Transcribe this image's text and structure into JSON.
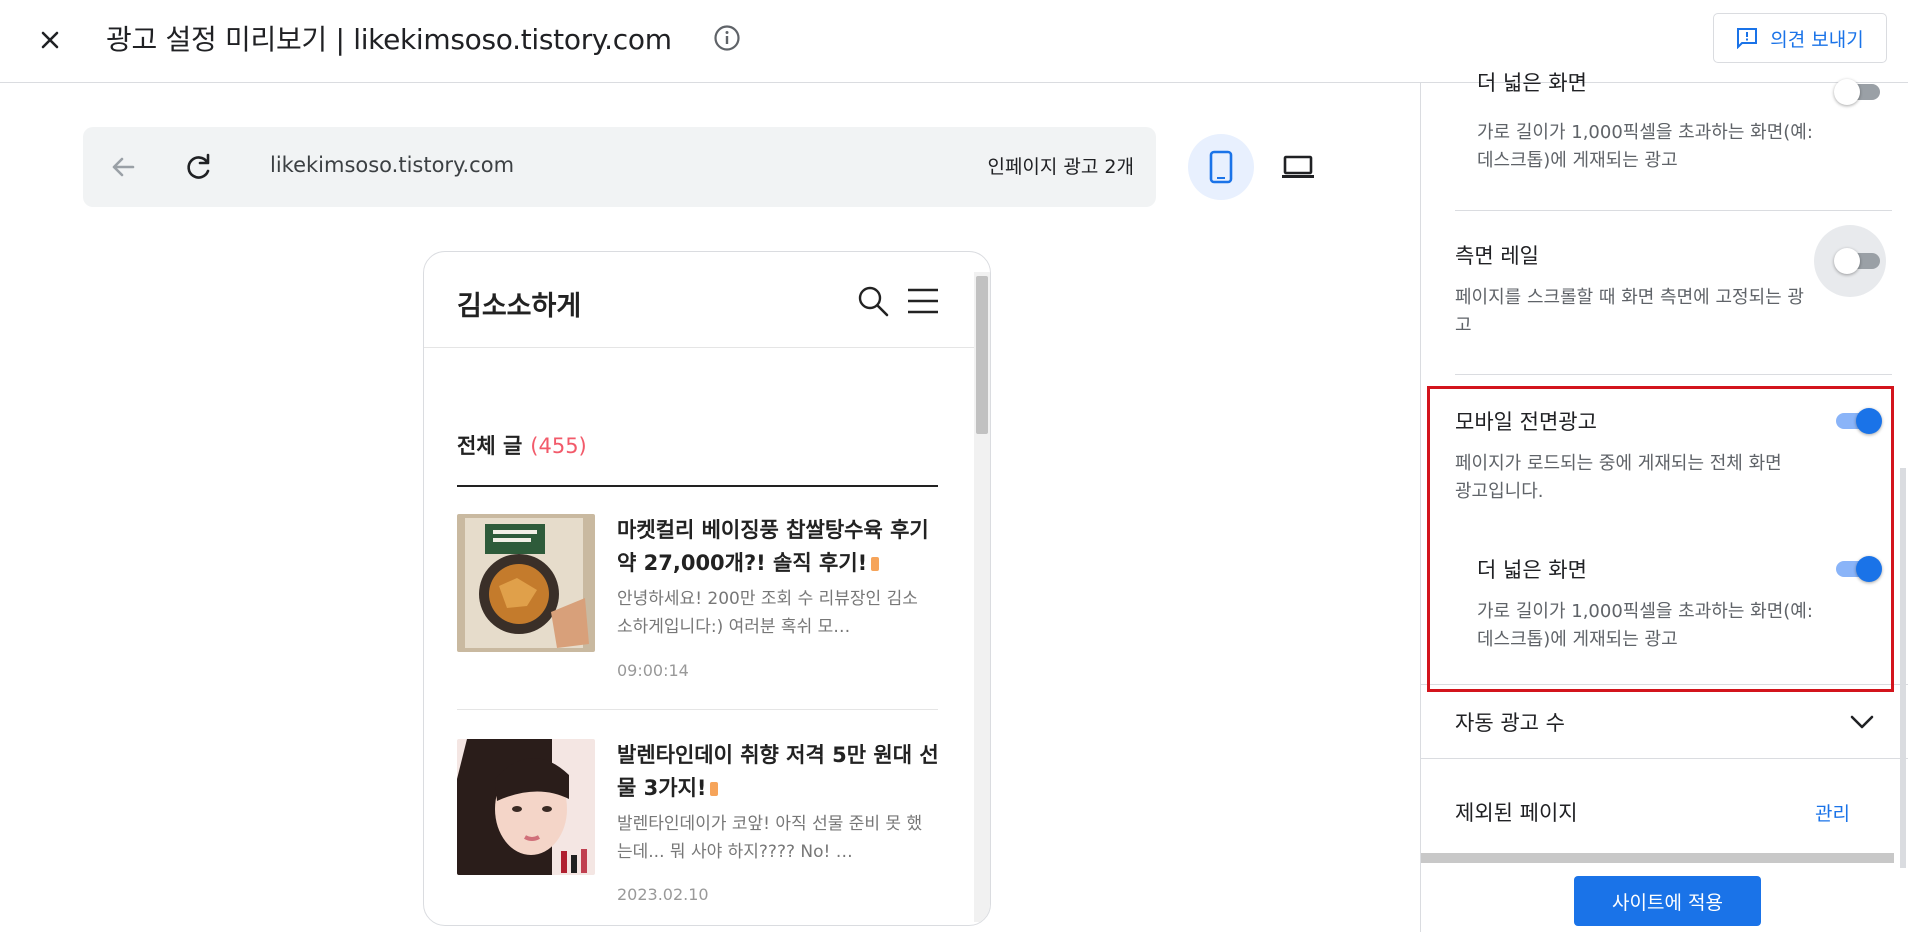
{
  "header": {
    "title": "광고 설정 미리보기 | likekimsoso.tistory.com",
    "feedback_label": "의견 보내기"
  },
  "preview": {
    "url": "likekimsoso.tistory.com",
    "ads_count": "인페이지 광고 2개"
  },
  "blog": {
    "name": "김소소하게",
    "all_posts_label": "전체 글",
    "all_posts_count": "(455)",
    "posts": [
      {
        "title": "마켓컬리 베이징풍 찹쌀탕수육 후기 약 27,000개?! 솔직 후기!",
        "excerpt": "안녕하세요! 200만 조회 수 리뷰장인 김소소하게입니다:) 여러분 혹쉬 모…",
        "date": "09:00:14"
      },
      {
        "title": "발렌타인데이 취향 저격 5만 원대 선물 3가지!",
        "excerpt": "발렌타인데이가 코앞! 아직 선물 준비 못 했는데... 뭐 사야 하지???? No! …",
        "date": "2023.02.10"
      }
    ]
  },
  "settings": {
    "top_title_partial": "더 넓은 화면",
    "top_desc": "가로 길이가 1,000픽셀을 초과하는 화면(예: 데스크톱)에 게재되는 광고",
    "side_rail_title": "측면 레일",
    "side_rail_desc": "페이지를 스크롤할 때 화면 측면에 고정되는 광고",
    "mobile_title": "모바일 전면광고",
    "mobile_desc": "페이지가 로드되는 중에 게재되는 전체 화면 광고입니다.",
    "wider_title": "더 넓은 화면",
    "wider_desc": "가로 길이가 1,000픽셀을 초과하는 화면(예: 데스크톱)에 게재되는 광고",
    "auto_ads_title": "자동 광고 수",
    "excluded_title": "제외된 페이지",
    "manage_label": "관리",
    "apply_label": "사이트에 적용"
  },
  "toggles": {
    "top_wider": false,
    "side_rail": false,
    "mobile_interstitial": true,
    "mobile_wider": true
  },
  "colors": {
    "accent": "#1a73e8",
    "highlight_border": "#d3141c",
    "post_count": "#f25a6a"
  }
}
